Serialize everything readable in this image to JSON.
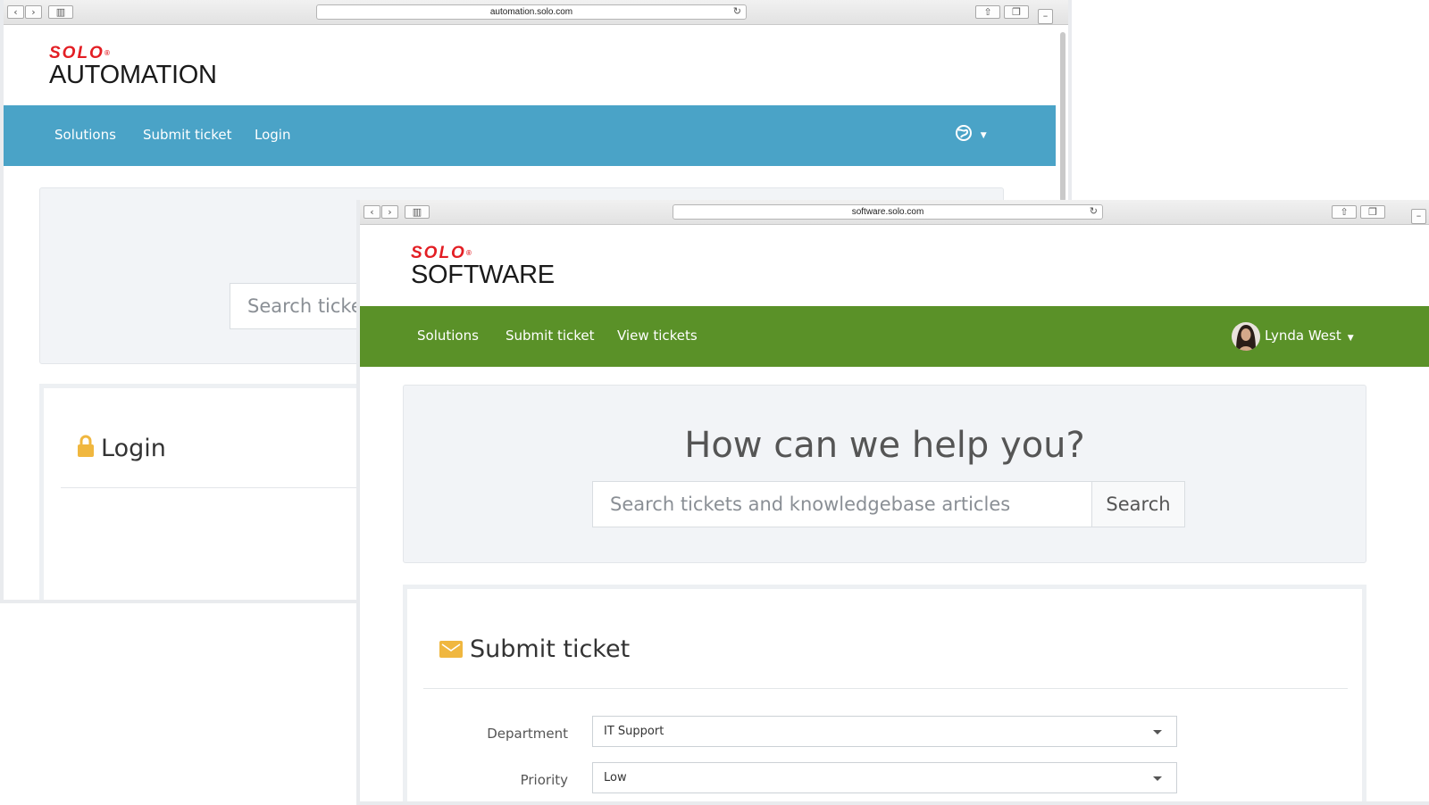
{
  "back_window": {
    "url": "automation.solo.com",
    "brand": {
      "mark": "SOLO",
      "registered": "®",
      "name": "AUTOMATION"
    },
    "nav": {
      "solutions": "Solutions",
      "submit_ticket": "Submit ticket",
      "login": "Login"
    },
    "search_placeholder": "Search tickets and knowledgebase articles",
    "login_heading": "Login",
    "colors": {
      "nav": "#4aa3c7"
    }
  },
  "front_window": {
    "url": "software.solo.com",
    "brand": {
      "mark": "SOLO",
      "registered": "®",
      "name": "SOFTWARE"
    },
    "nav": {
      "solutions": "Solutions",
      "submit_ticket": "Submit ticket",
      "view_tickets": "View tickets"
    },
    "user": {
      "name": "Lynda West"
    },
    "hero": {
      "title": "How can we help you?",
      "search_placeholder": "Search tickets and knowledgebase articles",
      "search_button": "Search"
    },
    "form": {
      "heading": "Submit ticket",
      "department_label": "Department",
      "department_value": "IT Support",
      "priority_label": "Priority",
      "priority_value": "Low"
    },
    "colors": {
      "nav": "#5a9128"
    }
  },
  "icons": {
    "back": "chevron-left-icon",
    "forward": "chevron-right-icon",
    "sidebar": "sidebar-icon",
    "reload": "reload-icon",
    "share": "share-icon",
    "tabs": "tabs-icon",
    "globe": "globe-icon",
    "lock": "lock-icon",
    "envelope": "envelope-icon"
  }
}
